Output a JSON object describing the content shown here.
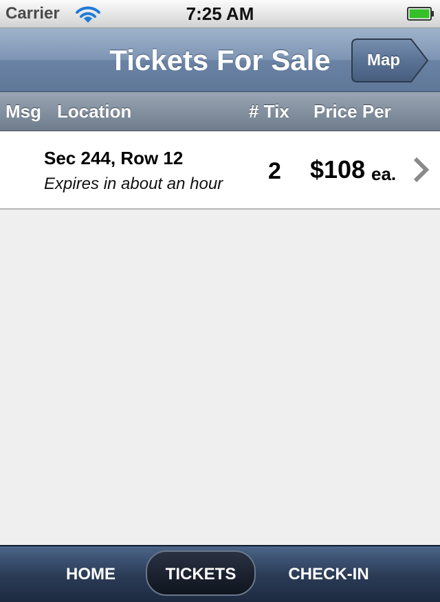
{
  "status_bar": {
    "carrier": "Carrier",
    "time": "7:25 AM",
    "wifi_icon": "wifi-icon",
    "battery_icon": "battery-full-icon",
    "battery_color": "#35c02a"
  },
  "nav": {
    "title": "Tickets For Sale",
    "map_button": "Map"
  },
  "columns": {
    "msg": "Msg",
    "location": "Location",
    "tix": "# Tix",
    "price": "Price Per"
  },
  "listings": [
    {
      "location": "Sec 244, Row 12",
      "expires": "Expires in about an hour",
      "quantity": "2",
      "price": "$108",
      "price_suffix": "ea.",
      "disclosure_icon": "chevron-right-icon"
    }
  ],
  "tabs": [
    {
      "label": "HOME",
      "selected": false
    },
    {
      "label": "TICKETS",
      "selected": true
    },
    {
      "label": "CHECK-IN",
      "selected": false
    }
  ],
  "colors": {
    "nav_bar": "#7d94b3",
    "tab_bar": "#2c3d58",
    "background": "#efefef"
  }
}
